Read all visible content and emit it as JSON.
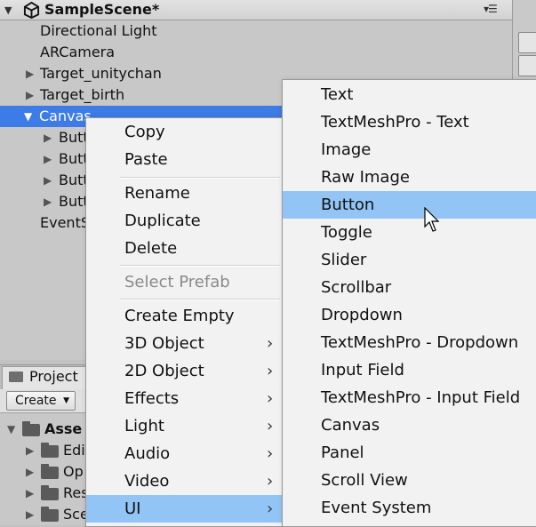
{
  "hierarchy": {
    "scene_title": "SampleScene*",
    "items": [
      {
        "label": "Directional Light"
      },
      {
        "label": "ARCamera"
      },
      {
        "label": "Target_unitychan"
      },
      {
        "label": "Target_birth"
      },
      {
        "label": "Canvas"
      },
      {
        "label": "Butt"
      },
      {
        "label": "Butt"
      },
      {
        "label": "Butt"
      },
      {
        "label": "Butt"
      },
      {
        "label": "EventS"
      }
    ],
    "selected_item": "Canvas"
  },
  "project": {
    "tab_label": "Project",
    "create_label": "Create",
    "items": [
      {
        "label": "Asse"
      },
      {
        "label": "Edi"
      },
      {
        "label": "Op"
      },
      {
        "label": "Res"
      },
      {
        "label": "Sce"
      }
    ]
  },
  "context_menu": {
    "items": [
      {
        "label": "Copy"
      },
      {
        "label": "Paste"
      },
      {
        "label": "Rename"
      },
      {
        "label": "Duplicate"
      },
      {
        "label": "Delete"
      },
      {
        "label": "Select Prefab",
        "disabled": true
      },
      {
        "label": "Create Empty"
      },
      {
        "label": "3D Object",
        "submenu": true
      },
      {
        "label": "2D Object",
        "submenu": true
      },
      {
        "label": "Effects",
        "submenu": true
      },
      {
        "label": "Light",
        "submenu": true
      },
      {
        "label": "Audio",
        "submenu": true
      },
      {
        "label": "Video",
        "submenu": true
      },
      {
        "label": "UI",
        "submenu": true
      }
    ],
    "highlighted": "UI",
    "submenu_arrow": "›"
  },
  "ui_submenu": {
    "items": [
      {
        "label": "Text"
      },
      {
        "label": "TextMeshPro - Text"
      },
      {
        "label": "Image"
      },
      {
        "label": "Raw Image"
      },
      {
        "label": "Button"
      },
      {
        "label": "Toggle"
      },
      {
        "label": "Slider"
      },
      {
        "label": "Scrollbar"
      },
      {
        "label": "Dropdown"
      },
      {
        "label": "TextMeshPro - Dropdown"
      },
      {
        "label": "Input Field"
      },
      {
        "label": "TextMeshPro - Input Field"
      },
      {
        "label": "Canvas"
      },
      {
        "label": "Panel"
      },
      {
        "label": "Scroll View"
      },
      {
        "label": "Event System"
      }
    ],
    "highlighted": "Button"
  },
  "colors": {
    "selection_blue": "#3d7be6",
    "menu_highlight": "#92c5f6",
    "menu_background": "#f2f2f2",
    "panel_background": "#c8c8c8"
  },
  "icons": [
    "unity-logo-icon",
    "menu-icon",
    "fold-arrow-icon",
    "folder-icon",
    "submenu-arrow-icon",
    "cursor-icon"
  ]
}
